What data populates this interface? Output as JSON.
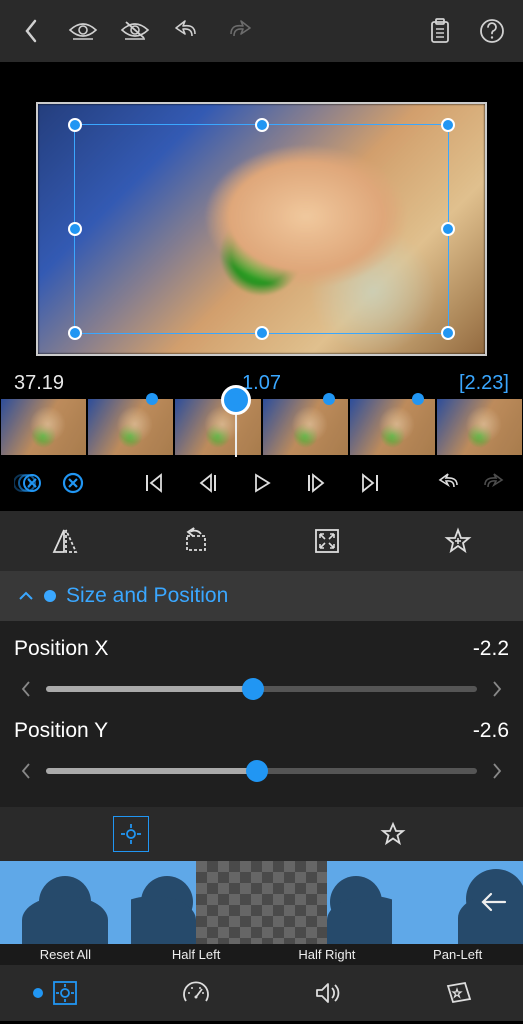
{
  "timeline": {
    "start": "37.19",
    "current": "1.07",
    "total": "[2.23]",
    "keyframes_pct": [
      29,
      45,
      63,
      80
    ],
    "playhead_pct": 45
  },
  "section": {
    "title": "Size and Position"
  },
  "sliders": {
    "posx": {
      "label": "Position X",
      "value": "-2.2",
      "thumb_pct": 48,
      "fill_pct": 48
    },
    "posy": {
      "label": "Position Y",
      "value": "-2.6",
      "thumb_pct": 49,
      "fill_pct": 49
    }
  },
  "presets": {
    "items": [
      {
        "label": "Reset All"
      },
      {
        "label": "Half Left"
      },
      {
        "label": "Half Right"
      },
      {
        "label": "Pan-Left"
      }
    ]
  }
}
